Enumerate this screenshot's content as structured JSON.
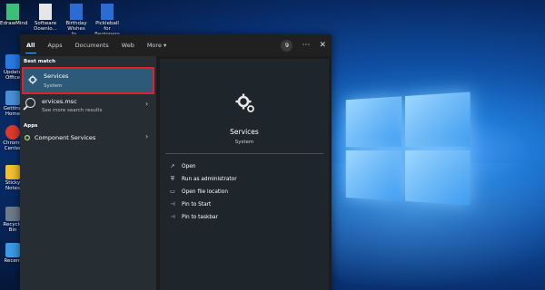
{
  "desktop": {
    "left_icons": [
      {
        "label": "Update\nOffice",
        "color": "#2a7ae4"
      },
      {
        "label": "Getting\nHome",
        "color": "#4a90d9"
      },
      {
        "label": "Chrome\nCenter",
        "color": "#dd3b2c"
      },
      {
        "label": "Sticky\nNotes",
        "color": "#f2c12e"
      },
      {
        "label": "Recycle\nBin",
        "color": "#6d7b8a"
      },
      {
        "label": "Recent",
        "color": "#3b9be5"
      }
    ],
    "top_icons": [
      {
        "label": "EdrawMind",
        "color": "#3bbf7a"
      },
      {
        "label": "Software\nDownlo...",
        "color": "#e6e6e6"
      },
      {
        "label": "Birthday\nWishes fo...",
        "color": "#2b6cd4"
      },
      {
        "label": "Pickleball for\nBeginners",
        "color": "#2b6cd4"
      }
    ]
  },
  "search": {
    "tabs": [
      "All",
      "Apps",
      "Documents",
      "Web",
      "More ▾"
    ],
    "result_count": "9",
    "more_icon": "⋯",
    "close_icon": "✕",
    "best_match_header": "Best match",
    "best_match": {
      "title": "Services",
      "subtitle": "System",
      "icon": "gear-icon"
    },
    "web_result": {
      "title": "ervices.msc",
      "subtitle": "See more search results"
    },
    "apps_header": "Apps",
    "apps": [
      {
        "title": "Component Services",
        "icon": "gear-icon"
      }
    ],
    "preview": {
      "title": "Services",
      "subtitle": "System",
      "actions": [
        {
          "label": "Open",
          "icon": "open-icon"
        },
        {
          "label": "Run as administrator",
          "icon": "shield-icon"
        },
        {
          "label": "Open file location",
          "icon": "folder-icon"
        },
        {
          "label": "Pin to Start",
          "icon": "pin-icon"
        },
        {
          "label": "Pin to taskbar",
          "icon": "pin-icon"
        }
      ]
    }
  }
}
